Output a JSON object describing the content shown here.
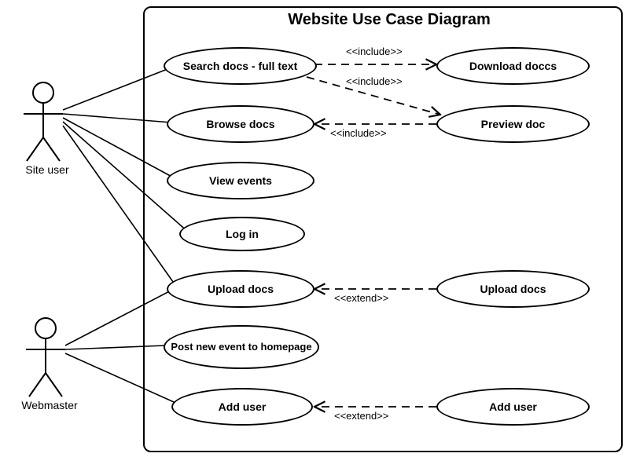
{
  "diagram": {
    "title": "Website Use Case Diagram",
    "actors": {
      "site_user": "Site user",
      "webmaster": "Webmaster"
    },
    "usecases": {
      "search_docs": "Search docs - full text",
      "browse_docs": "Browse docs",
      "view_events": "View events",
      "log_in": "Log in",
      "upload_docs": "Upload docs",
      "post_event": "Post new event to homepage",
      "add_user": "Add user",
      "download_docs": "Download doccs",
      "preview_doc": "Preview doc",
      "upload_docs_ext": "Upload docs",
      "add_user_ext": "Add user"
    },
    "stereotypes": {
      "include": "<<include>>",
      "extend": "<<extend>>"
    }
  }
}
